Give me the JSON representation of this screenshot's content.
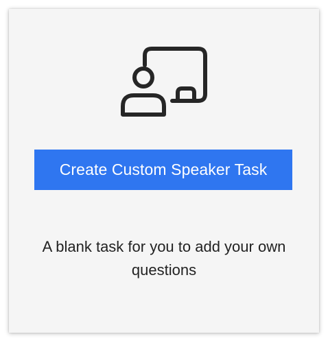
{
  "card": {
    "icon": "presenter-whiteboard-icon",
    "button_label": "Create Custom Speaker Task",
    "description": "A blank task for you to add your own questions"
  },
  "colors": {
    "accent": "#2f76f0",
    "card_background": "#f5f5f5",
    "icon_stroke": "#262626",
    "text": "#222222"
  }
}
